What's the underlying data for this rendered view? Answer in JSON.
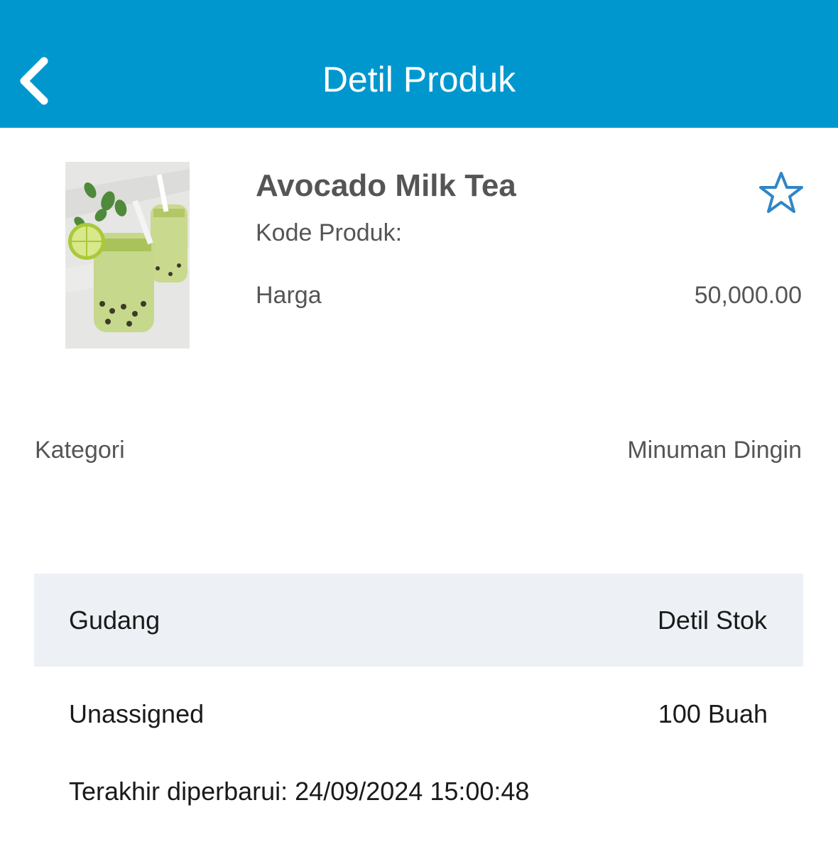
{
  "header": {
    "title": "Detil Produk",
    "back_icon": "chevron-left-icon",
    "background_color": "#0097cf"
  },
  "product": {
    "name": "Avocado Milk Tea",
    "code_label": "Kode Produk:",
    "price_label": "Harga",
    "price_value": "50,000.00",
    "favorite_icon": "star-outline-icon",
    "image_description_icon": "product-photo"
  },
  "category": {
    "label": "Kategori",
    "value": "Minuman Dingin"
  },
  "stock_table": {
    "header_left": "Gudang",
    "header_right": "Detil Stok",
    "rows": [
      {
        "warehouse": "Unassigned",
        "quantity": "100 Buah",
        "updated": "Terakhir diperbarui: 24/09/2024 15:00:48"
      }
    ]
  }
}
